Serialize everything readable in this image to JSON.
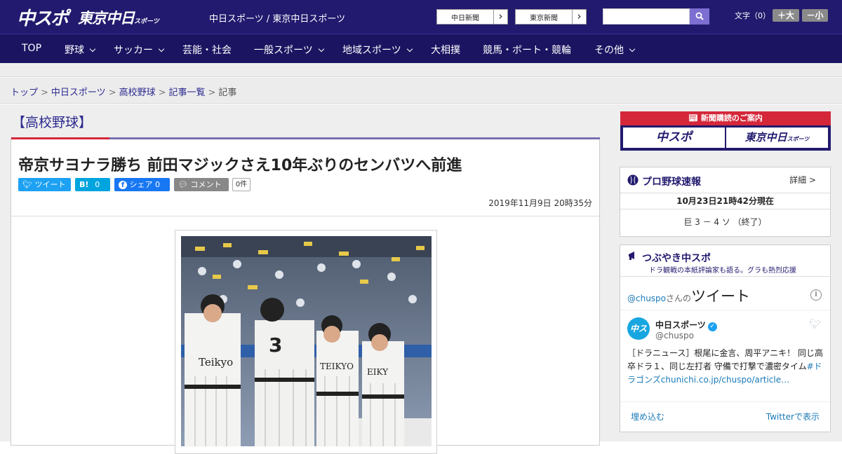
{
  "header": {
    "logo_chuspo": "中スポ",
    "logo_tokyo": "東京中日",
    "logo_tokyo_small": "スポーツ",
    "site_name": "中日スポーツ / 東京中日スポーツ",
    "paper_links": [
      {
        "label": "中日新聞"
      },
      {
        "label": "東京新聞"
      }
    ],
    "search_placeholder": "",
    "font_size_label": "文字（0）",
    "font_larger": "＋大",
    "font_smaller": "－小"
  },
  "nav": {
    "items": [
      {
        "label": "TOP",
        "dropdown": false
      },
      {
        "label": "野球",
        "dropdown": true
      },
      {
        "label": "サッカー",
        "dropdown": true
      },
      {
        "label": "芸能・社会",
        "dropdown": false
      },
      {
        "label": "一般スポーツ",
        "dropdown": true
      },
      {
        "label": "地域スポーツ",
        "dropdown": true
      },
      {
        "label": "大相撲",
        "dropdown": false
      },
      {
        "label": "競馬・ボート・競輪",
        "dropdown": false
      },
      {
        "label": "その他",
        "dropdown": true
      }
    ]
  },
  "breadcrumb": {
    "items": [
      "トップ",
      "中日スポーツ",
      "高校野球",
      "記事一覧"
    ],
    "current": "記事",
    "separator": ">"
  },
  "article": {
    "category_tag": "【高校野球】",
    "headline": "帝京サヨナラ勝ち 前田マジックさえ10年ぶりのセンバツへ前進",
    "share": {
      "tweet_label": "ツイート",
      "hatena_label": "B!",
      "hatena_count": "0",
      "facebook_label": "シェア",
      "facebook_count": "0",
      "comment_label": "コメント",
      "comment_count": "0件"
    },
    "datetime": "2019年11月9日 20時35分"
  },
  "sidebar": {
    "promo": {
      "title": "新聞購読のご案内",
      "button_chuspo": "中スポ",
      "button_tokyo": "東京中日",
      "button_tokyo_small": "スポーツ"
    },
    "baseball_live": {
      "title": "プロ野球速報",
      "detail_link": "詳細 >",
      "as_of": "10月23日21時42分現在",
      "score": "巨 3 － 4 ソ （終了）"
    },
    "tweets": {
      "title": "つぶやき中スポ",
      "subtitle": "ドラ観戦の本紙評論家も語る。グラも熱烈応援",
      "header_handle": "@chuspo",
      "header_san": "さんの",
      "header_word": "ツイート",
      "info": "i",
      "account_name": "中日スポーツ",
      "avatar_text": "中スポ",
      "account_handle": "@chuspo",
      "tweet_text_plain": "［ドラニュース］根尾に金言、周平アニキ！ 同じ高卒ドラ１、同じ左打者 守備で打撃で濃密タイム",
      "tweet_hashtag": "#ドラゴンズ",
      "tweet_link": "chunichi.co.jp/chuspo/article…",
      "embed_label": "埋め込む",
      "view_on_twitter": "Twitterで表示"
    }
  },
  "colors": {
    "header_bg": "#221a6e",
    "nav_bg": "#1b1461",
    "accent_red": "#d4273a",
    "link_blue": "#2d2b8f",
    "twitter_blue": "#1da1f2",
    "facebook_blue": "#1877f2",
    "hatena_blue": "#00a4de"
  }
}
